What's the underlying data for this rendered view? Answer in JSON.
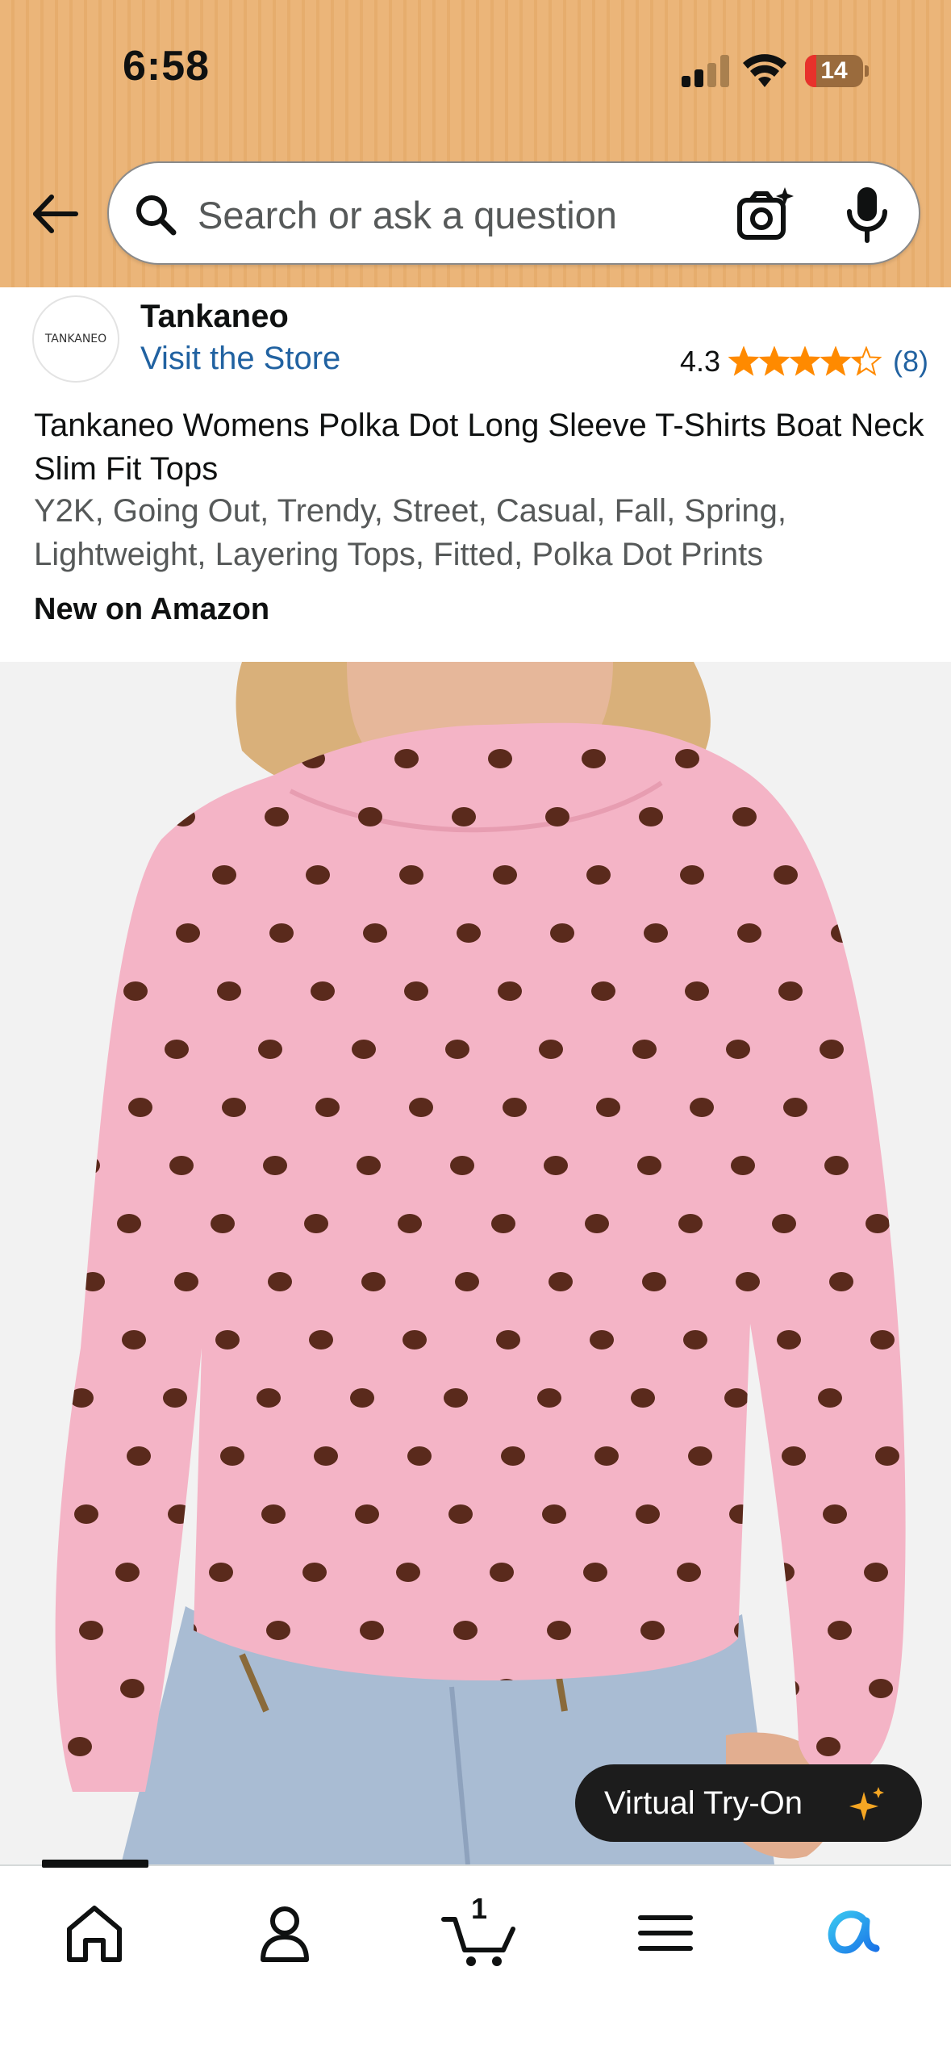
{
  "status_bar": {
    "time": "6:58",
    "battery_level": "14",
    "battery_color": "#e8312b",
    "icons": [
      "signal-icon",
      "wifi-icon",
      "battery-icon"
    ]
  },
  "header": {
    "back_icon": "back-arrow-icon",
    "search": {
      "placeholder": "Search or ask a question",
      "value": ""
    },
    "camera_icon": "camera-search-icon",
    "mic_icon": "microphone-icon",
    "background_color": "#ebb579"
  },
  "brand": {
    "logo_text": "TANKANEO",
    "name": "Tankaneo",
    "store_link": "Visit the Store",
    "rating": "4.3",
    "rating_count": "(8)",
    "stars_filled": 4.3,
    "star_color": "#ff8a00"
  },
  "product": {
    "title": "Tankaneo Womens Polka Dot Long Sleeve T-Shirts Boat Neck Slim Fit Tops",
    "tags": "Y2K, Going Out, Trendy, Street, Casual, Fall, Spring, Lightweight, Layering Tops, Fitted, Polka Dot Prints",
    "badge": "New on Amazon",
    "image_description_icon": "product-photo",
    "shirt_color": "#f4b4c6",
    "dot_color": "#5a2a1c"
  },
  "virtual_tryon": {
    "label": "Virtual Try-On",
    "icon": "sparkle-icon"
  },
  "bottom_nav": {
    "items": [
      {
        "icon": "home-icon"
      },
      {
        "icon": "account-icon"
      },
      {
        "icon": "cart-icon",
        "count": "1"
      },
      {
        "icon": "menu-icon"
      },
      {
        "icon": "rufus-icon"
      }
    ]
  }
}
